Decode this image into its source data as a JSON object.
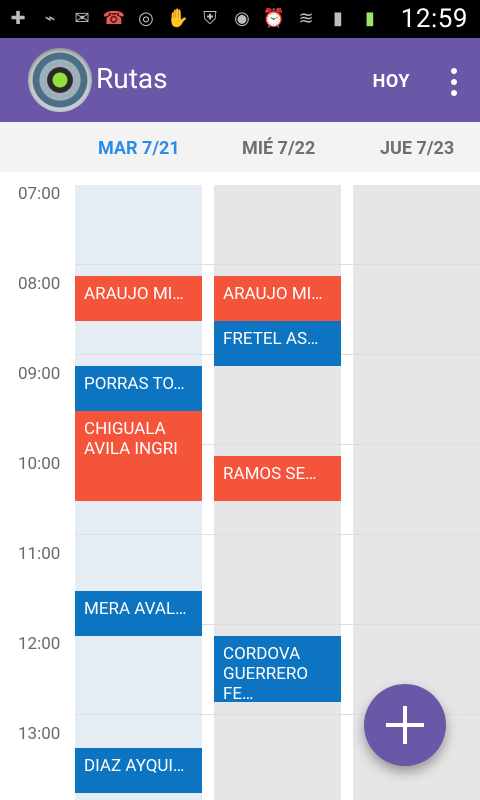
{
  "status": {
    "time": "12:59"
  },
  "appbar": {
    "title": "Rutas",
    "today_label": "HOY"
  },
  "days": [
    {
      "label": "MAR 7/21",
      "active": true
    },
    {
      "label": "MIÉ 7/22",
      "active": false
    },
    {
      "label": "JUE 7/23",
      "active": false
    }
  ],
  "hours": [
    "07:00",
    "08:00",
    "09:00",
    "10:00",
    "11:00",
    "12:00",
    "13:00"
  ],
  "events": [
    {
      "day": 0,
      "label": "ARAUJO MI…",
      "color": "#f4553a"
    },
    {
      "day": 0,
      "label": "PORRAS TO…",
      "color": "#0d74c1"
    },
    {
      "day": 0,
      "label": "CHIGUALA AVILA INGRI",
      "color": "#f4553a"
    },
    {
      "day": 0,
      "label": "MERA AVAL…",
      "color": "#0d74c1"
    },
    {
      "day": 0,
      "label": "DIAZ AYQUI…",
      "color": "#0d74c1"
    },
    {
      "day": 1,
      "label": "ARAUJO MI…",
      "color": "#f4553a"
    },
    {
      "day": 1,
      "label": "FRETEL AS…",
      "color": "#0d74c1"
    },
    {
      "day": 1,
      "label": "RAMOS SE…",
      "color": "#f4553a"
    },
    {
      "day": 1,
      "label": "CORDOVA GUERRERO FE…",
      "color": "#0d74c1"
    }
  ]
}
